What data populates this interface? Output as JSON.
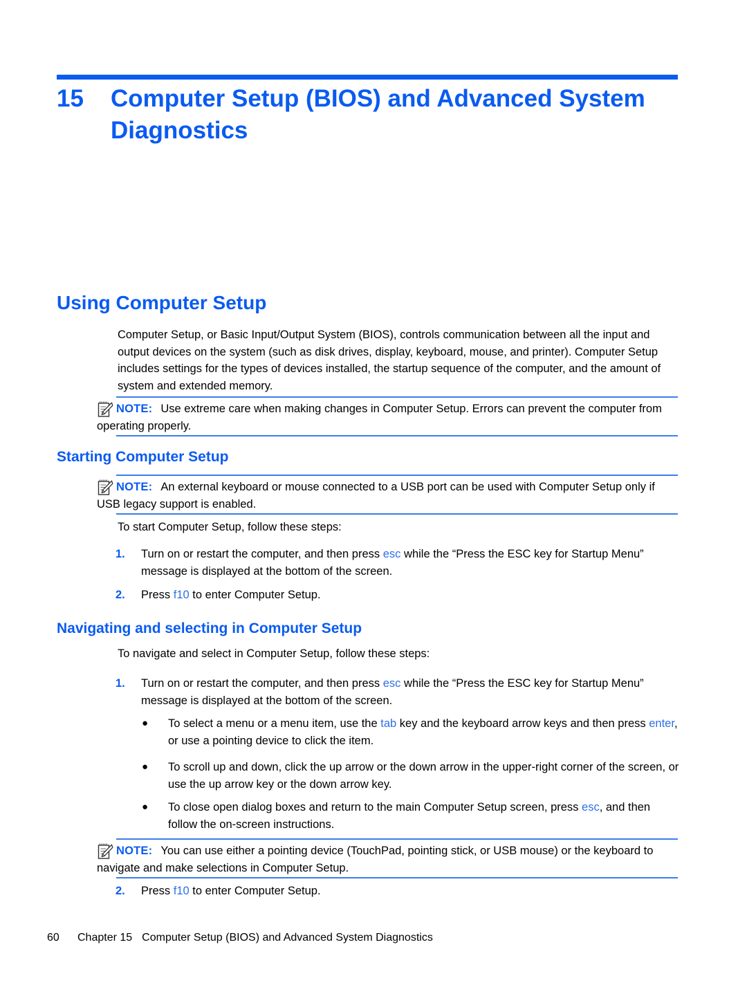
{
  "document": {
    "type": "user-guide-page",
    "accent_color": "#0a5bf0",
    "note_rule_color": "#3b7fe8",
    "key_color": "#2e6fe8"
  },
  "chapter": {
    "number": "15",
    "title": "Computer Setup (BIOS) and Advanced System Diagnostics"
  },
  "sections": {
    "using": {
      "heading": "Using Computer Setup",
      "paragraph": "Computer Setup, or Basic Input/Output System (BIOS), controls communication between all the input and output devices on the system (such as disk drives, display, keyboard, mouse, and printer). Computer Setup includes settings for the types of devices installed, the startup sequence of the computer, and the amount of system and extended memory.",
      "note": {
        "label": "NOTE:",
        "icon": "note-pencil-icon",
        "text": "Use extreme care when making changes in Computer Setup. Errors can prevent the computer from operating properly."
      }
    },
    "starting": {
      "heading": "Starting Computer Setup",
      "note": {
        "label": "NOTE:",
        "icon": "note-pencil-icon",
        "text": "An external keyboard or mouse connected to a USB port can be used with Computer Setup only if USB legacy support is enabled."
      },
      "intro": "To start Computer Setup, follow these steps:",
      "steps": [
        {
          "number": "1.",
          "parts": [
            {
              "t": "Turn on or restart the computer, and then press "
            },
            {
              "t": "esc",
              "key": true
            },
            {
              "t": " while the “Press the ESC key for Startup Menu” message is displayed at the bottom of the screen."
            }
          ]
        },
        {
          "number": "2.",
          "parts": [
            {
              "t": "Press "
            },
            {
              "t": "f10",
              "key": true
            },
            {
              "t": " to enter Computer Setup."
            }
          ]
        }
      ]
    },
    "navigating": {
      "heading": "Navigating and selecting in Computer Setup",
      "intro": "To navigate and select in Computer Setup, follow these steps:",
      "step1": {
        "number": "1.",
        "parts": [
          {
            "t": "Turn on or restart the computer, and then press "
          },
          {
            "t": "esc",
            "key": true
          },
          {
            "t": " while the “Press the ESC key for Startup Menu” message is displayed at the bottom of the screen."
          }
        ]
      },
      "bullets": [
        {
          "marker": "●",
          "parts": [
            {
              "t": "To select a menu or a menu item, use the "
            },
            {
              "t": "tab",
              "key": true
            },
            {
              "t": " key and the keyboard arrow keys and then press "
            },
            {
              "t": "enter",
              "key": true
            },
            {
              "t": ", or use a pointing device to click the item."
            }
          ]
        },
        {
          "marker": "●",
          "parts": [
            {
              "t": "To scroll up and down, click the up arrow or the down arrow in the upper-right corner of the screen, or use the up arrow key or the down arrow key."
            }
          ]
        },
        {
          "marker": "●",
          "parts": [
            {
              "t": "To close open dialog boxes and return to the main Computer Setup screen, press "
            },
            {
              "t": "esc",
              "key": true
            },
            {
              "t": ", and then follow the on-screen instructions."
            }
          ]
        }
      ],
      "note": {
        "label": "NOTE:",
        "icon": "note-pencil-icon",
        "text": "You can use either a pointing device (TouchPad, pointing stick, or USB mouse) or the keyboard to navigate and make selections in Computer Setup."
      },
      "step2": {
        "number": "2.",
        "parts": [
          {
            "t": "Press "
          },
          {
            "t": "f10",
            "key": true
          },
          {
            "t": " to enter Computer Setup."
          }
        ]
      }
    }
  },
  "footer": {
    "page_number": "60",
    "chapter_label": "Chapter 15",
    "chapter_title": "Computer Setup (BIOS) and Advanced System Diagnostics"
  }
}
